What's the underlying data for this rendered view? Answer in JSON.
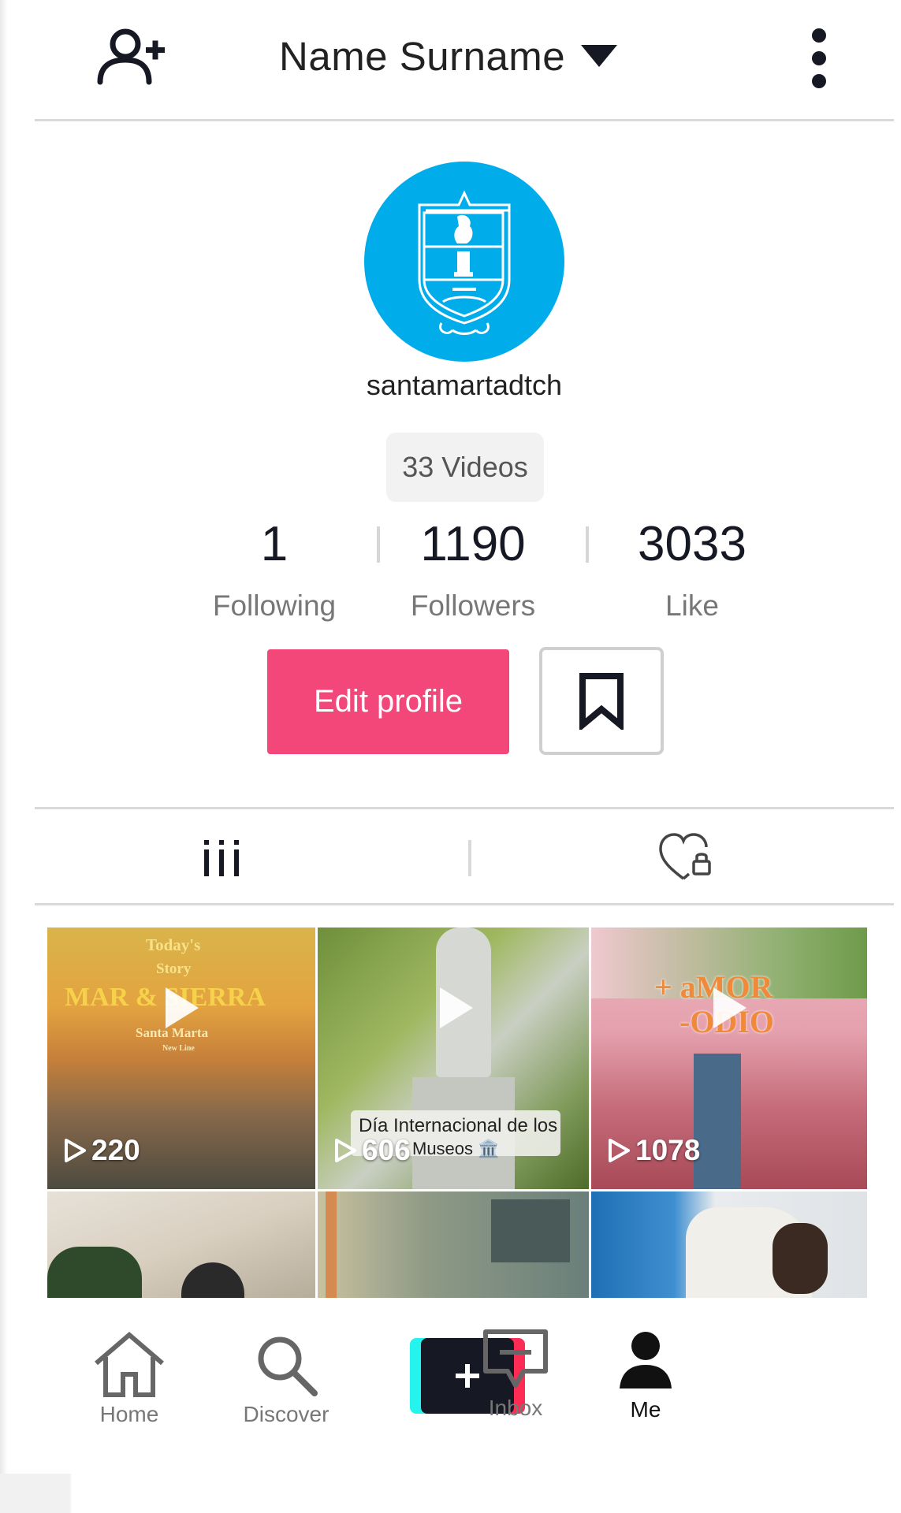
{
  "header": {
    "title": "Name Surname",
    "add_user_icon": "add-user-icon",
    "dropdown_icon": "caret-down-icon",
    "menu_icon": "kebab-menu-icon"
  },
  "profile": {
    "username": "santamartadtch",
    "videos_count": "33 Videos",
    "stats": [
      {
        "value": "1",
        "label": "Following"
      },
      {
        "value": "1190",
        "label": "Followers"
      },
      {
        "value": "3033",
        "label": "Like"
      }
    ],
    "edit_label": "Edit profile",
    "bookmark_icon": "bookmark-icon"
  },
  "tabs": {
    "videos_icon": "grid-icon",
    "liked_icon": "heart-lock-icon"
  },
  "videos": [
    {
      "views": "220",
      "overlay_lines": [
        "Today's",
        "Story",
        "MAR & SIERRA",
        "Santa Marta",
        "New Line"
      ]
    },
    {
      "views": "606",
      "caption_line1": "Día Internacional de los",
      "caption_line2": "Museos 🏛️"
    },
    {
      "views": "1078",
      "overlay_lines": [
        "+ aMOR",
        "-ODIO"
      ]
    },
    {
      "views": ""
    },
    {
      "views": ""
    },
    {
      "views": ""
    }
  ],
  "nav": {
    "home": "Home",
    "discover": "Discover",
    "inbox": "Inbox",
    "me": "Me"
  },
  "colors": {
    "accent": "#f3477a",
    "avatar_bg": "#00adea",
    "tiktok_cyan": "#25f4ee",
    "tiktok_red": "#fe2c55"
  }
}
